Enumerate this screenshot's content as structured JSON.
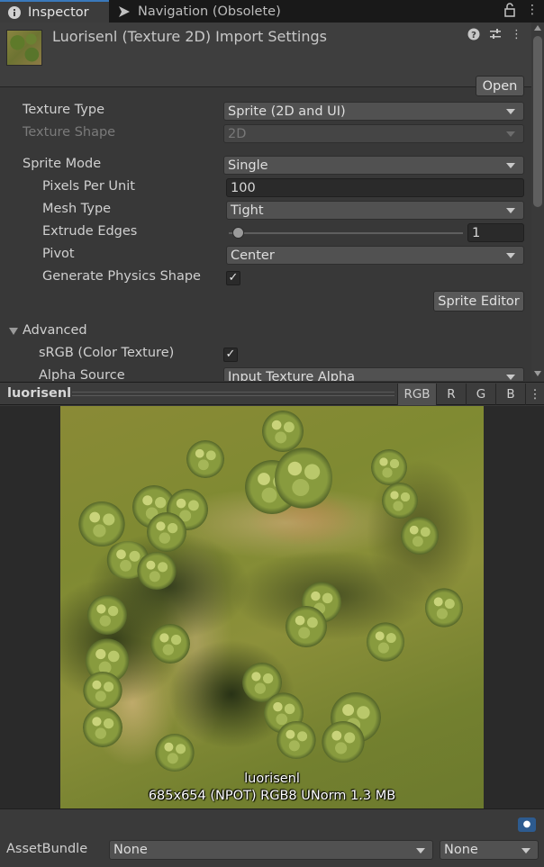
{
  "tabs": {
    "inspector": "Inspector",
    "navigation": "Navigation (Obsolete)"
  },
  "header": {
    "title": "Luorisenl (Texture 2D) Import Settings",
    "open_label": "Open"
  },
  "settings": {
    "texture_type": {
      "label": "Texture Type",
      "value": "Sprite (2D and UI)"
    },
    "texture_shape": {
      "label": "Texture Shape",
      "value": "2D"
    },
    "sprite_mode": {
      "label": "Sprite Mode",
      "value": "Single"
    },
    "pixels_per_unit": {
      "label": "Pixels Per Unit",
      "value": "100"
    },
    "mesh_type": {
      "label": "Mesh Type",
      "value": "Tight"
    },
    "extrude_edges": {
      "label": "Extrude Edges",
      "value": "1",
      "slider_fraction": 0.04
    },
    "pivot": {
      "label": "Pivot",
      "value": "Center"
    },
    "generate_physics_shape": {
      "label": "Generate Physics Shape",
      "checked": true,
      "mark": "✓"
    },
    "sprite_editor_label": "Sprite Editor",
    "advanced_label": "Advanced",
    "srgb": {
      "label": "sRGB (Color Texture)",
      "checked": true,
      "mark": "✓"
    },
    "alpha_source": {
      "label": "Alpha Source",
      "value": "Input Texture Alpha"
    }
  },
  "preview": {
    "name": "luorisenl",
    "channels": [
      "RGB",
      "R",
      "G",
      "B"
    ],
    "active_channel": "RGB",
    "caption_name": "luorisenl",
    "caption_info": "685x654 (NPOT)  RGB8 UNorm   1.3 MB"
  },
  "bottom": {
    "assetbundle_label": "AssetBundle",
    "assetbundle_value": "None",
    "variant_value": "None"
  },
  "colors": {
    "accent": "#3a79bb",
    "panel": "#383838"
  }
}
